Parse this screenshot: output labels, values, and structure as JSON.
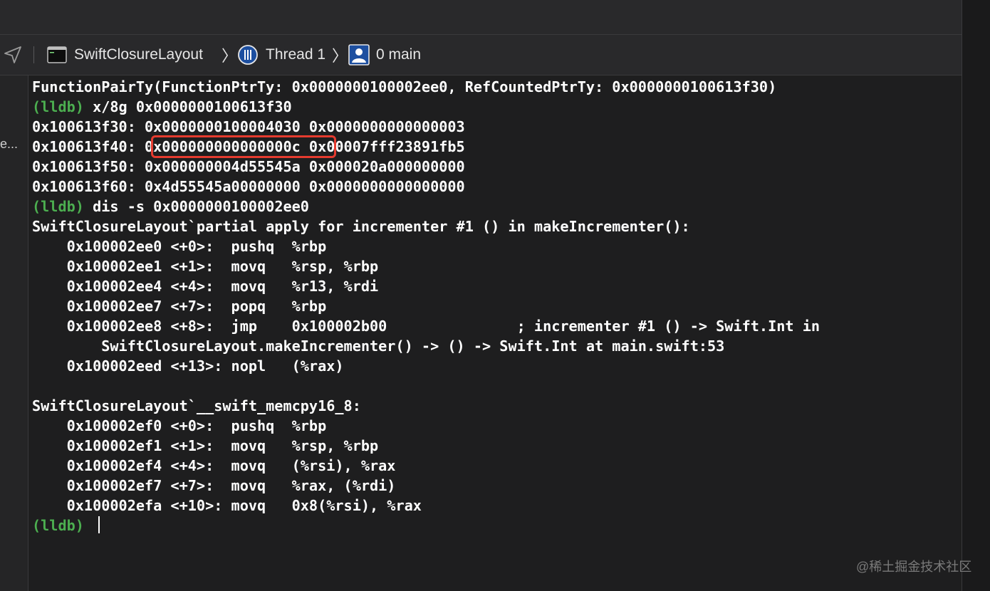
{
  "jumpbar": {
    "project": "SwiftClosureLayout",
    "thread": "Thread 1",
    "frame": "0 main"
  },
  "gutter": {
    "truncated_label": "e..."
  },
  "console": {
    "lines": [
      {
        "prompt": "",
        "text": "FunctionPairTy(FunctionPtrTy: 0x0000000100002ee0, RefCountedPtrTy: 0x0000000100613f30)"
      },
      {
        "prompt": "(lldb)",
        "text": " x/8g 0x0000000100613f30"
      },
      {
        "prompt": "",
        "text": "0x100613f30: 0x0000000100004030 0x0000000000000003"
      },
      {
        "prompt": "",
        "text": "0x100613f40: 0x000000000000000c 0x00007fff23891fb5"
      },
      {
        "prompt": "",
        "text": "0x100613f50: 0x000000004d55545a 0x000020a000000000"
      },
      {
        "prompt": "",
        "text": "0x100613f60: 0x4d55545a00000000 0x0000000000000000"
      },
      {
        "prompt": "(lldb)",
        "text": " dis -s 0x0000000100002ee0"
      },
      {
        "prompt": "",
        "text": "SwiftClosureLayout`partial apply for incrementer #1 () in makeIncrementer():"
      },
      {
        "prompt": "",
        "text": "    0x100002ee0 <+0>:  pushq  %rbp"
      },
      {
        "prompt": "",
        "text": "    0x100002ee1 <+1>:  movq   %rsp, %rbp"
      },
      {
        "prompt": "",
        "text": "    0x100002ee4 <+4>:  movq   %r13, %rdi"
      },
      {
        "prompt": "",
        "text": "    0x100002ee7 <+7>:  popq   %rbp"
      },
      {
        "prompt": "",
        "text": "    0x100002ee8 <+8>:  jmp    0x100002b00               ; incrementer #1 () -> Swift.Int in"
      },
      {
        "prompt": "",
        "text": "        SwiftClosureLayout.makeIncrementer() -> () -> Swift.Int at main.swift:53"
      },
      {
        "prompt": "",
        "text": "    0x100002eed <+13>: nopl   (%rax)"
      },
      {
        "prompt": "",
        "text": ""
      },
      {
        "prompt": "",
        "text": "SwiftClosureLayout`__swift_memcpy16_8:"
      },
      {
        "prompt": "",
        "text": "    0x100002ef0 <+0>:  pushq  %rbp"
      },
      {
        "prompt": "",
        "text": "    0x100002ef1 <+1>:  movq   %rsp, %rbp"
      },
      {
        "prompt": "",
        "text": "    0x100002ef4 <+4>:  movq   (%rsi), %rax"
      },
      {
        "prompt": "",
        "text": "    0x100002ef7 <+7>:  movq   %rax, (%rdi)"
      },
      {
        "prompt": "",
        "text": "    0x100002efa <+10>: movq   0x8(%rsi), %rax"
      },
      {
        "prompt": "(lldb)",
        "text": " "
      }
    ]
  },
  "highlight": {
    "value": "0x000000000000000c",
    "color": "#e53b2f"
  },
  "colors": {
    "background": "#1e1e1f",
    "prompt": "#4caf50",
    "text": "#ffffff"
  },
  "watermark": "@稀土掘金技术社区"
}
